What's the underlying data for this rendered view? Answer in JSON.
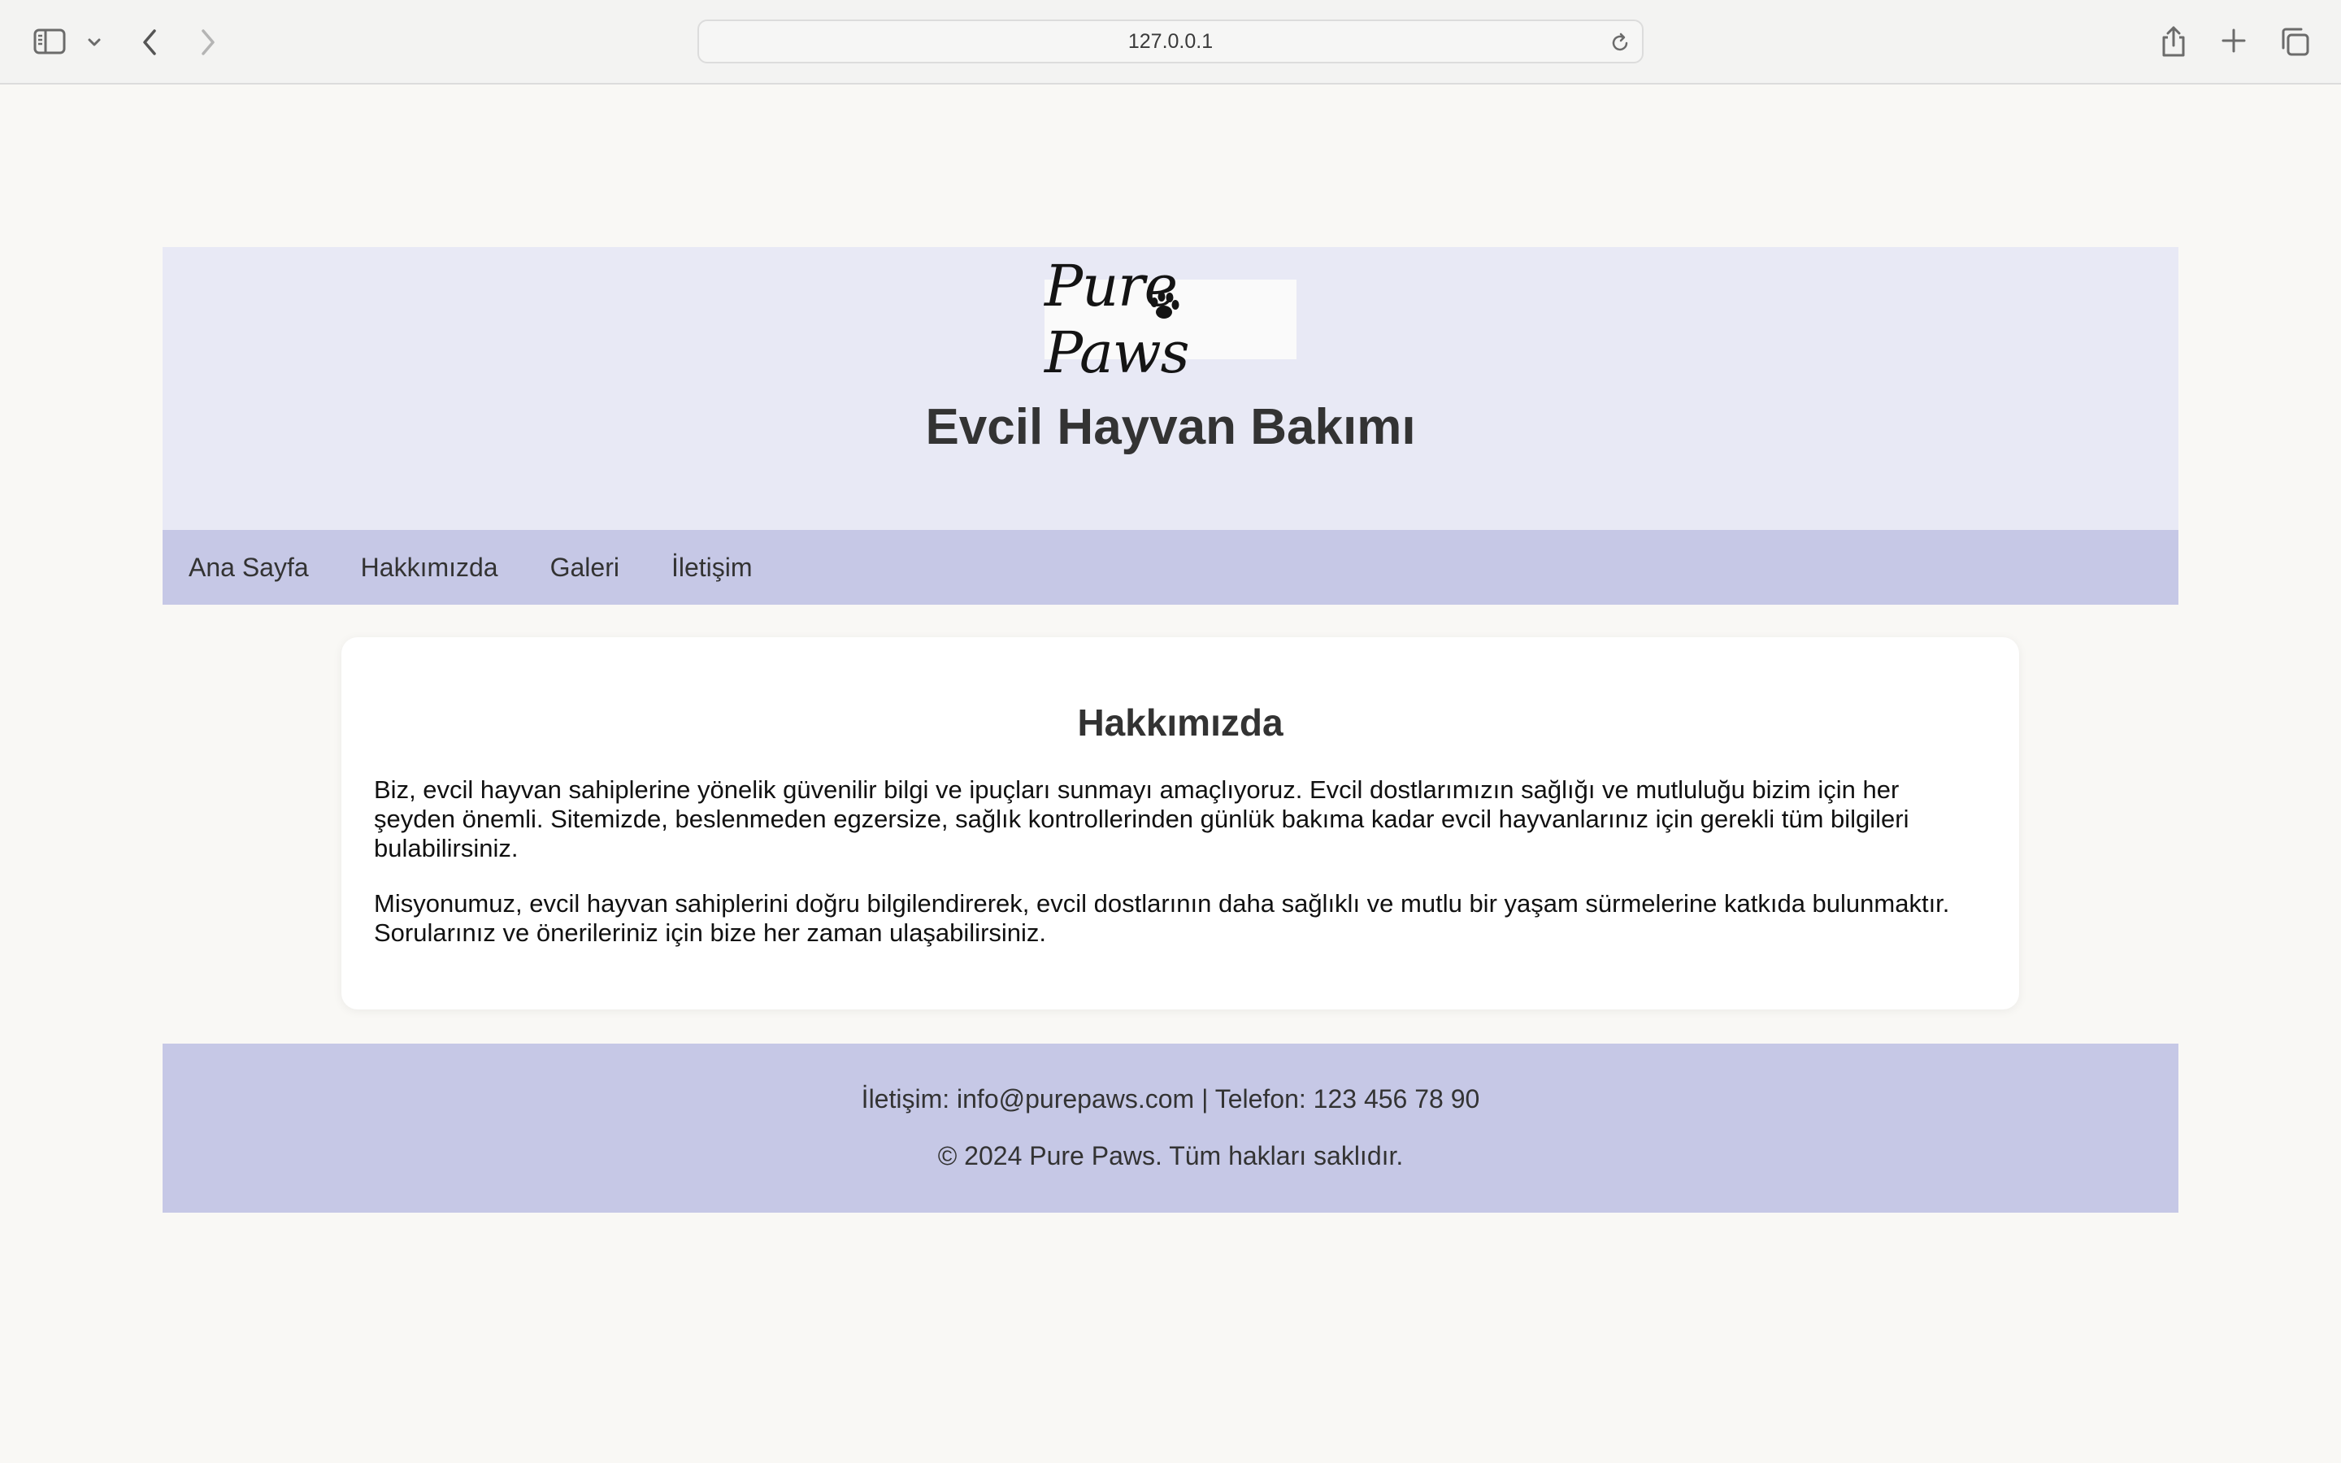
{
  "browser": {
    "url": "127.0.0.1",
    "icons": [
      "sidebar-icon",
      "chevron-down-icon",
      "back-icon",
      "forward-icon",
      "reload-icon",
      "share-icon",
      "plus-icon",
      "tabs-icon"
    ]
  },
  "header": {
    "logo_text": "Pure Paws",
    "title": "Evcil Hayvan Bakımı"
  },
  "nav": {
    "items": [
      {
        "label": "Ana Sayfa"
      },
      {
        "label": "Hakkımızda"
      },
      {
        "label": "Galeri"
      },
      {
        "label": "İletişim"
      }
    ]
  },
  "main": {
    "section_title": "Hakkımızda",
    "paragraphs": [
      "Biz, evcil hayvan sahiplerine yönelik güvenilir bilgi ve ipuçları sunmayı amaçlıyoruz. Evcil dostlarımızın sağlığı ve mutluluğu bizim için her şeyden önemli. Sitemizde, beslenmeden egzersize, sağlık kontrollerinden günlük bakıma kadar evcil hayvanlarınız için gerekli tüm bilgileri bulabilirsiniz.",
      "Misyonumuz, evcil hayvan sahiplerini doğru bilgilendirerek, evcil dostlarının daha sağlıklı ve mutlu bir yaşam sürmelerine katkıda bulunmaktır. Sorularınız ve önerileriniz için bize her zaman ulaşabilirsiniz."
    ]
  },
  "footer": {
    "contact": "İletişim: info@purepaws.com | Telefon: 123 456 78 90",
    "copyright": "© 2024 Pure Paws. Tüm hakları saklıdır."
  },
  "colors": {
    "header_bg": "#e8e9f5",
    "nav_bg": "#c6c8e6",
    "page_bg": "#f9f8f5",
    "card_bg": "#ffffff",
    "text": "#333333"
  }
}
